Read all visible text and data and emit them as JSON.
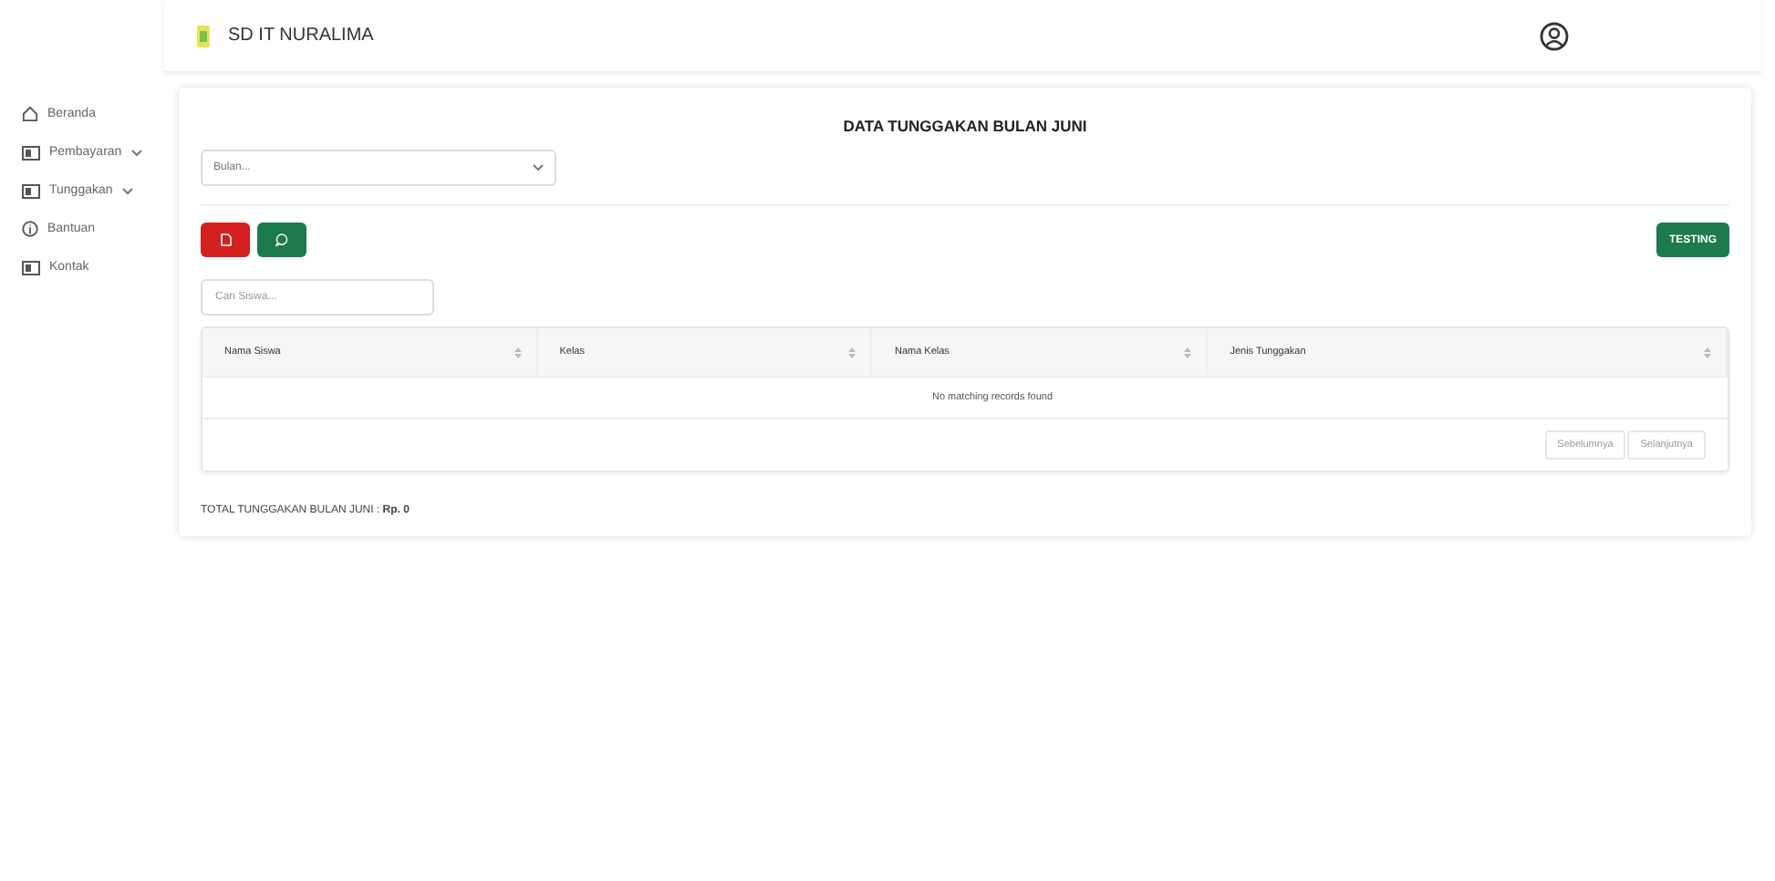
{
  "header": {
    "school_name": "SD IT NURALIMA"
  },
  "sidebar": {
    "items": [
      {
        "label": "Beranda",
        "has_submenu": false
      },
      {
        "label": "Pembayaran",
        "has_submenu": true
      },
      {
        "label": "Tunggakan",
        "has_submenu": true
      },
      {
        "label": "Bantuan",
        "has_submenu": false
      },
      {
        "label": "Kontak",
        "has_submenu": false
      }
    ]
  },
  "card": {
    "title": "DATA TUNGGAKAN BULAN JUNI",
    "month_select": {
      "placeholder": "Bulan..."
    },
    "testing_button": "TESTING",
    "search": {
      "placeholder": "Cari Siswa..."
    },
    "table": {
      "columns": [
        "Nama Siswa",
        "Kelas",
        "Nama Kelas",
        "Jenis Tunggakan"
      ],
      "empty_message": "No matching records found"
    },
    "pagination": [
      "Sebelumnya",
      "Selanjutnya"
    ],
    "total": "TOTAL TUNGGAKAN BULAN JUNI : **Rp. 0**"
  }
}
